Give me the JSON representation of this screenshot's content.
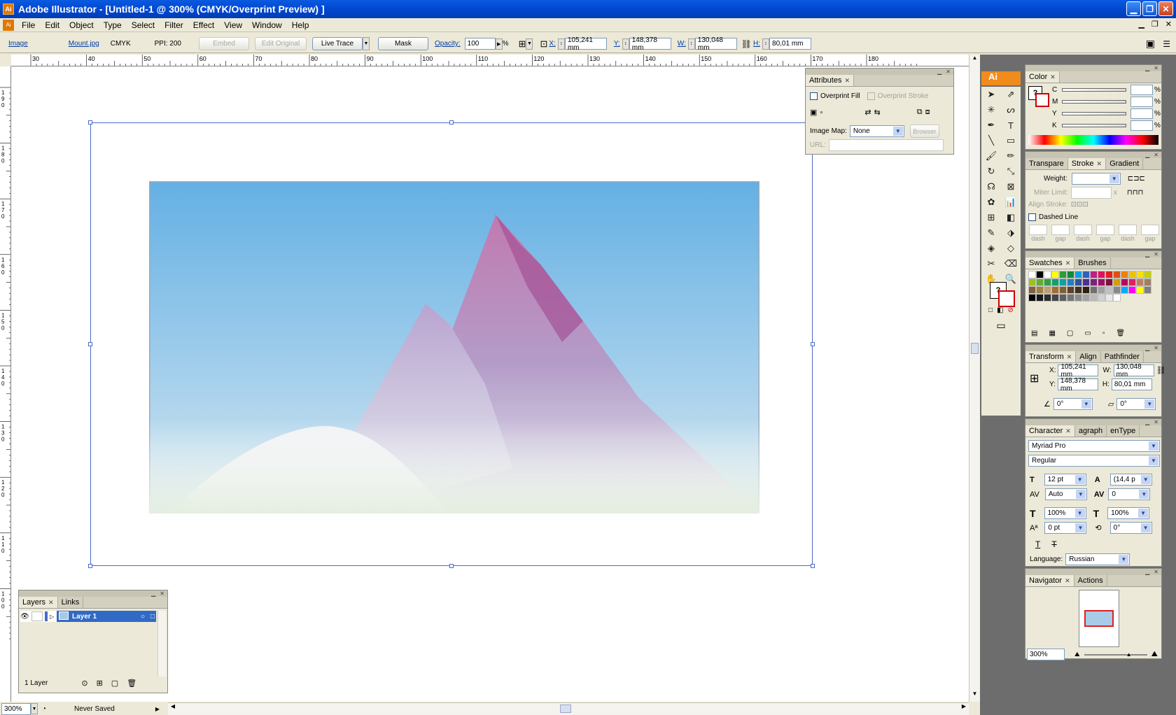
{
  "window": {
    "title": "Adobe Illustrator - [Untitled-1 @ 300% (CMYK/Overprint Preview) ]",
    "app_icon": "Ai"
  },
  "menu": [
    "File",
    "Edit",
    "Object",
    "Type",
    "Select",
    "Filter",
    "Effect",
    "View",
    "Window",
    "Help"
  ],
  "control": {
    "kind": "Image",
    "file": "Mount.jpg",
    "mode": "CMYK",
    "ppi": "PPI: 200",
    "embed": "Embed",
    "edit_original": "Edit Original",
    "live_trace": "Live Trace",
    "mask": "Mask",
    "opacity_label": "Opacity:",
    "opacity": "100",
    "pct": "%",
    "x_label": "X:",
    "x": "105,241 mm",
    "y_label": "Y:",
    "y": "148,378 mm",
    "w_label": "W:",
    "w": "130,048 mm",
    "h_label": "H:",
    "h": "80,01 mm"
  },
  "ruler": {
    "h_ticks": [
      "30",
      "40",
      "50",
      "60",
      "70",
      "80",
      "90",
      "100",
      "110",
      "120",
      "130",
      "140",
      "150",
      "160",
      "170",
      "180"
    ],
    "v_ticks": [
      "190",
      "180",
      "170",
      "160",
      "150",
      "140",
      "130",
      "120",
      "110",
      "100"
    ]
  },
  "attributes": {
    "tab": "Attributes",
    "overprint_fill": "Overprint Fill",
    "overprint_stroke": "Overprint Stroke",
    "image_map_label": "Image Map:",
    "image_map": "None",
    "browser": "Browser",
    "url_label": "URL:"
  },
  "layers": {
    "tabs": [
      "Layers",
      "Links"
    ],
    "layer_name": "Layer 1",
    "count": "1 Layer"
  },
  "status": {
    "zoom": "300%",
    "saved": "Never Saved"
  },
  "color_panel": {
    "tab": "Color",
    "channels": [
      "C",
      "M",
      "Y",
      "K"
    ],
    "pct": "%"
  },
  "stroke_panel": {
    "tabs": [
      "Transpare",
      "Stroke",
      "Gradient"
    ],
    "weight": "Weight:",
    "miter": "Miter Limit:",
    "miter_x": "x",
    "align": "Align Stroke:",
    "dashed": "Dashed Line",
    "dash_labels": [
      "dash",
      "gap",
      "dash",
      "gap",
      "dash",
      "gap"
    ]
  },
  "swatches": {
    "tabs": [
      "Swatches",
      "Brushes"
    ]
  },
  "transform": {
    "tabs": [
      "Transform",
      "Align",
      "Pathfinder"
    ],
    "x_label": "X:",
    "x": "105,241 mm",
    "w_label": "W:",
    "w": "130,048 mm",
    "y_label": "Y:",
    "y": "148,378 mm",
    "h_label": "H:",
    "h": "80,01 mm",
    "angle": "0°",
    "shear": "0°"
  },
  "character": {
    "tabs": [
      "Character",
      "agraph",
      "enType"
    ],
    "font": "Myriad Pro",
    "style": "Regular",
    "size": "12 pt",
    "leading": "(14,4 p",
    "kerning": "Auto",
    "tracking": "0",
    "vscale": "100%",
    "hscale": "100%",
    "baseline": "0 pt",
    "rotation": "0°",
    "language_label": "Language:",
    "language": "Russian"
  },
  "navigator": {
    "tabs": [
      "Navigator",
      "Actions"
    ],
    "zoom": "300%"
  },
  "colors": {
    "title": "#0054e3",
    "canvas": "#ffffff",
    "dock": "#6d6d6d",
    "selection": "#4a6ac8"
  }
}
